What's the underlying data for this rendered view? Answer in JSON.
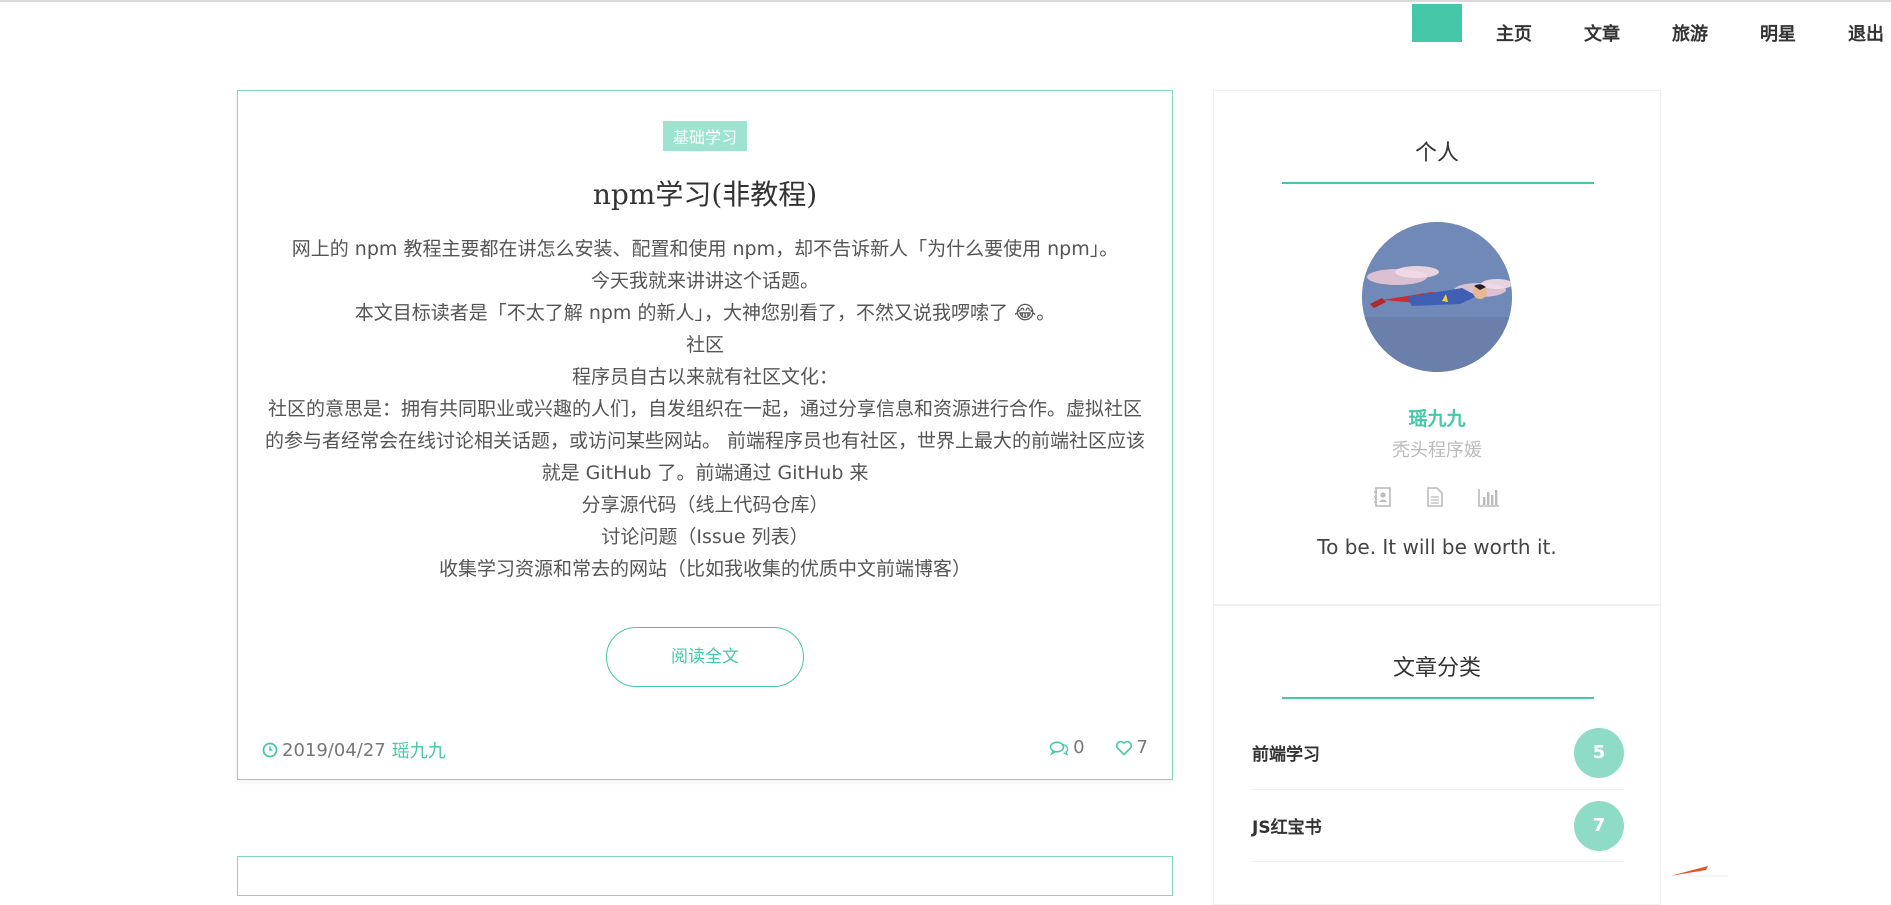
{
  "nav": {
    "items": [
      "主页",
      "文章",
      "旅游",
      "明星",
      "退出"
    ],
    "accent": "#45c8a7"
  },
  "article": {
    "tag": "基础学习",
    "title": "npm学习(非教程)",
    "excerpt": [
      "网上的 npm 教程主要都在讲怎么安装、配置和使用 npm，却不告诉新人「为什么要使用 npm」。",
      "今天我就来讲讲这个话题。",
      "本文目标读者是「不太了解 npm 的新人」，大神您别看了，不然又说我啰嗦了 😂。",
      "社区",
      "程序员自古以来就有社区文化：",
      "社区的意思是：拥有共同职业或兴趣的人们，自发组织在一起，通过分享信息和资源进行合作。虚拟社区的参与者经常会在线讨论相关话题，或访问某些网站。 前端程序员也有社区，世界上最大的前端社区应该就是 GitHub 了。前端通过 GitHub 来",
      "分享源代码（线上代码仓库）",
      "讨论问题（Issue 列表）",
      "收集学习资源和常去的网站（比如我收集的优质中文前端博客）"
    ],
    "read_more": "阅读全文",
    "date": "2019/04/27",
    "author": "瑶九九",
    "comments": "0",
    "likes": "7"
  },
  "sidebar": {
    "profile": {
      "title": "个人",
      "name": "瑶九九",
      "subtitle": "秃头程序媛",
      "icons": [
        "contact-icon",
        "document-icon",
        "bar-chart-icon"
      ],
      "motto": "To be. It will be worth it."
    },
    "categories": {
      "title": "文章分类",
      "items": [
        {
          "name": "前端学习",
          "count": "5"
        },
        {
          "name": "JS红宝书",
          "count": "7"
        }
      ]
    }
  }
}
